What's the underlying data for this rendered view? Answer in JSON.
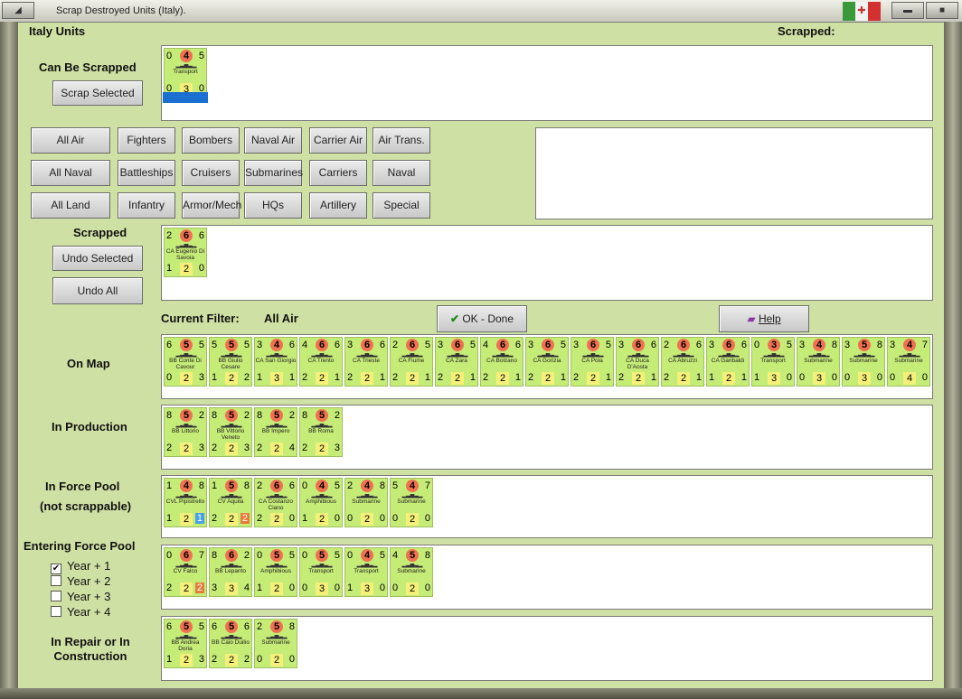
{
  "window": {
    "title": "Scrap Destroyed Units (Italy).",
    "flag_colors": [
      "#3a9a3a",
      "#f2f2f2",
      "#d43030"
    ]
  },
  "header": {
    "left": "Italy Units",
    "right": "Scrapped:"
  },
  "can_be_scrapped": {
    "label": "Can Be Scrapped",
    "button": "Scrap Selected",
    "units": [
      {
        "top": [
          "0",
          "4",
          "5"
        ],
        "name": "Transport",
        "bot": [
          "0",
          "3",
          "0"
        ]
      }
    ]
  },
  "filters": [
    [
      "All Air",
      "Fighters",
      "Bombers",
      "Naval Air",
      "Carrier Air",
      "Air Trans."
    ],
    [
      "All Naval",
      "Battleships",
      "Cruisers",
      "Submarines",
      "Carriers",
      "Naval Trans."
    ],
    [
      "All Land",
      "Infantry",
      "Armor/Mech",
      "HQs",
      "Artillery",
      "Special"
    ]
  ],
  "scrapped": {
    "label": "Scrapped",
    "undo_selected": "Undo Selected",
    "undo_all": "Undo All",
    "units": [
      {
        "top": [
          "2",
          "6",
          "6"
        ],
        "name": "CA Eugenio Di Savoia",
        "bot": [
          "1",
          "2",
          "0"
        ]
      }
    ]
  },
  "current_filter": {
    "label": "Current Filter:",
    "value": "All Air"
  },
  "ok_button": "OK - Done",
  "help_button": "Help",
  "sections": {
    "on_map": {
      "label": "On Map",
      "units": [
        {
          "top": [
            "6",
            "5",
            "5"
          ],
          "name": "BB Conte Di Cavour",
          "bot": [
            "0",
            "2",
            "3"
          ]
        },
        {
          "top": [
            "5",
            "5",
            "5"
          ],
          "name": "BB Giulio Cesare",
          "bot": [
            "1",
            "2",
            "2"
          ]
        },
        {
          "top": [
            "3",
            "4",
            "6"
          ],
          "name": "CA San Giorgio",
          "bot": [
            "1",
            "3",
            "1"
          ]
        },
        {
          "top": [
            "4",
            "6",
            "6"
          ],
          "name": "CA Trento",
          "bot": [
            "2",
            "2",
            "1"
          ]
        },
        {
          "top": [
            "3",
            "6",
            "6"
          ],
          "name": "CA Trieste",
          "bot": [
            "2",
            "2",
            "1"
          ]
        },
        {
          "top": [
            "2",
            "6",
            "5"
          ],
          "name": "CA Fiume",
          "bot": [
            "2",
            "2",
            "1"
          ]
        },
        {
          "top": [
            "3",
            "6",
            "5"
          ],
          "name": "CA Zara",
          "bot": [
            "2",
            "2",
            "1"
          ]
        },
        {
          "top": [
            "4",
            "6",
            "6"
          ],
          "name": "CA Bolzano",
          "bot": [
            "2",
            "2",
            "1"
          ]
        },
        {
          "top": [
            "3",
            "6",
            "5"
          ],
          "name": "CA Gorizia",
          "bot": [
            "2",
            "2",
            "1"
          ]
        },
        {
          "top": [
            "3",
            "6",
            "5"
          ],
          "name": "CA Pola",
          "bot": [
            "2",
            "2",
            "1"
          ]
        },
        {
          "top": [
            "3",
            "6",
            "6"
          ],
          "name": "CA Duca D'Aosta",
          "bot": [
            "2",
            "2",
            "1"
          ]
        },
        {
          "top": [
            "2",
            "6",
            "6"
          ],
          "name": "CA Abruzzi",
          "bot": [
            "2",
            "2",
            "1"
          ]
        },
        {
          "top": [
            "3",
            "6",
            "6"
          ],
          "name": "CA Garibaldi",
          "bot": [
            "1",
            "2",
            "1"
          ]
        },
        {
          "top": [
            "0",
            "3",
            "5"
          ],
          "name": "Transport",
          "bot": [
            "1",
            "3",
            "0"
          ]
        },
        {
          "top": [
            "3",
            "4",
            "8"
          ],
          "name": "Submarine",
          "bot": [
            "0",
            "3",
            "0"
          ]
        },
        {
          "top": [
            "3",
            "5",
            "8"
          ],
          "name": "Submarine",
          "bot": [
            "0",
            "3",
            "0"
          ]
        },
        {
          "top": [
            "3",
            "4",
            "7"
          ],
          "name": "Submarine",
          "bot": [
            "0",
            "4",
            "0"
          ]
        }
      ]
    },
    "in_production": {
      "label": "In Production",
      "units": [
        {
          "top": [
            "8",
            "5",
            "2"
          ],
          "name": "BB Littorio",
          "bot": [
            "2",
            "2",
            "3"
          ]
        },
        {
          "top": [
            "8",
            "5",
            "2"
          ],
          "name": "BB Vittorio Veneto",
          "bot": [
            "2",
            "2",
            "3"
          ]
        },
        {
          "top": [
            "8",
            "5",
            "2"
          ],
          "name": "BB Impero",
          "bot": [
            "2",
            "2",
            "4"
          ]
        },
        {
          "top": [
            "8",
            "5",
            "2"
          ],
          "name": "BB Roma",
          "bot": [
            "2",
            "2",
            "3"
          ]
        }
      ]
    },
    "force_pool": {
      "label": "In Force Pool",
      "sublabel": "(not scrappable)",
      "units": [
        {
          "top": [
            "1",
            "4",
            "8"
          ],
          "name": "CVL Pipistrello",
          "bot": [
            "1",
            "2",
            "1"
          ],
          "hl": "hl1"
        },
        {
          "top": [
            "1",
            "5",
            "8"
          ],
          "name": "CV Aquila",
          "bot": [
            "2",
            "2",
            "2"
          ],
          "hl": "hl2"
        },
        {
          "top": [
            "2",
            "6",
            "6"
          ],
          "name": "CA Costanzo Ciano",
          "bot": [
            "2",
            "2",
            "0"
          ]
        },
        {
          "top": [
            "0",
            "4",
            "5"
          ],
          "name": "Amphibious",
          "bot": [
            "1",
            "2",
            "0"
          ]
        },
        {
          "top": [
            "2",
            "4",
            "8"
          ],
          "name": "Submarine",
          "bot": [
            "0",
            "2",
            "0"
          ]
        },
        {
          "top": [
            "5",
            "4",
            "7"
          ],
          "name": "Submarine",
          "bot": [
            "0",
            "2",
            "0"
          ]
        }
      ]
    },
    "entering_force_pool": {
      "label": "Entering Force Pool",
      "units": [
        {
          "top": [
            "0",
            "6",
            "7"
          ],
          "name": "CV Falco",
          "bot": [
            "2",
            "2",
            "2"
          ],
          "hl": "hl2"
        },
        {
          "top": [
            "8",
            "6",
            "2"
          ],
          "name": "BB Lepanto",
          "bot": [
            "3",
            "3",
            "4"
          ]
        },
        {
          "top": [
            "0",
            "5",
            "5"
          ],
          "name": "Amphibious",
          "bot": [
            "1",
            "2",
            "0"
          ]
        },
        {
          "top": [
            "0",
            "5",
            "5"
          ],
          "name": "Transport",
          "bot": [
            "0",
            "3",
            "0"
          ]
        },
        {
          "top": [
            "0",
            "4",
            "5"
          ],
          "name": "Transport",
          "bot": [
            "1",
            "3",
            "0"
          ]
        },
        {
          "top": [
            "4",
            "5",
            "8"
          ],
          "name": "Submarine",
          "bot": [
            "0",
            "2",
            "0"
          ]
        }
      ]
    },
    "in_repair": {
      "label": "In Repair or In Construction",
      "units": [
        {
          "top": [
            "6",
            "5",
            "5"
          ],
          "name": "BB Andrea Doria",
          "bot": [
            "1",
            "2",
            "3"
          ]
        },
        {
          "top": [
            "6",
            "5",
            "6"
          ],
          "name": "BB Caio Duilio",
          "bot": [
            "2",
            "2",
            "2"
          ]
        },
        {
          "top": [
            "2",
            "5",
            "8"
          ],
          "name": "Submarine",
          "bot": [
            "0",
            "2",
            "0"
          ]
        }
      ]
    }
  },
  "year_options": [
    {
      "label": "Year + 1",
      "checked": true
    },
    {
      "label": "Year + 2",
      "checked": false
    },
    {
      "label": "Year + 3",
      "checked": false
    },
    {
      "label": "Year + 4",
      "checked": false
    }
  ],
  "ship_glyph": "▂▃▅▃▂"
}
